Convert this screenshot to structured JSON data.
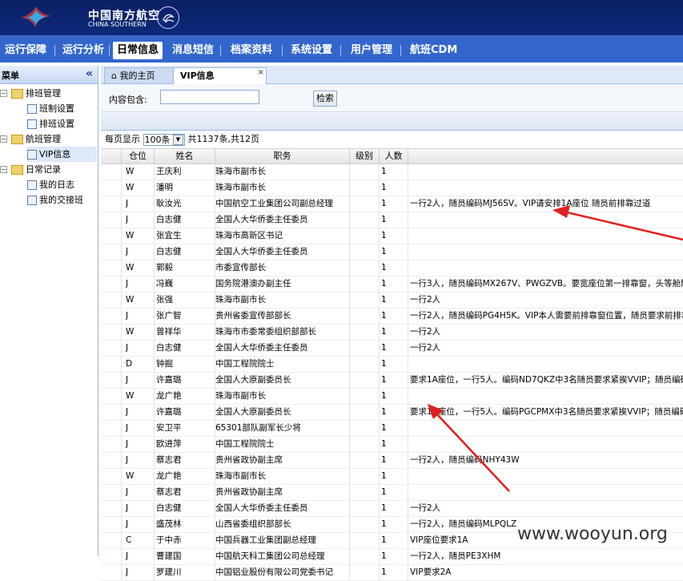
{
  "header": {
    "brand_cn": "中国南方航空",
    "brand_en": "CHINA SOUTHERN",
    "colors": {
      "bar": "#0b1f66",
      "nav": "#3366cc",
      "accent": "#e03b3b"
    }
  },
  "nav": [
    {
      "label": "运行保障"
    },
    {
      "label": "运行分析"
    },
    {
      "label": "日常信息",
      "active": true
    },
    {
      "label": "消息短信"
    },
    {
      "label": "档案资料"
    },
    {
      "label": "系统设置"
    },
    {
      "label": "用户管理"
    },
    {
      "label": "航班CDM"
    }
  ],
  "sidebar": {
    "title": "菜单",
    "collapse_icon": "double-chevron-left-icon",
    "items": [
      {
        "label": "排班管理",
        "type": "folder"
      },
      {
        "label": "班制设置",
        "type": "leaf"
      },
      {
        "label": "排班设置",
        "type": "leaf"
      },
      {
        "label": "航班管理",
        "type": "folder"
      },
      {
        "label": "VIP信息",
        "type": "leaf",
        "selected": true
      },
      {
        "label": "日常记录",
        "type": "folder"
      },
      {
        "label": "我的日志",
        "type": "leaf"
      },
      {
        "label": "我的交接班",
        "type": "leaf"
      }
    ]
  },
  "tabs": [
    {
      "label": "我的主页",
      "icon": "home-icon"
    },
    {
      "label": "VIP信息",
      "active": true,
      "close": "×"
    }
  ],
  "search": {
    "label": "内容包含:",
    "value": "",
    "button": "检索"
  },
  "paging": {
    "prefix": "每页显示",
    "page_size": "100条",
    "suffix": "共1137条,共12页"
  },
  "grid": {
    "columns": [
      "仓位",
      "姓名",
      "职务",
      "级别",
      "人数"
    ],
    "rows": [
      {
        "seat": "W",
        "name": "王庆利",
        "title": "珠海市副市长",
        "count": "1",
        "note": ""
      },
      {
        "seat": "W",
        "name": "潘明",
        "title": "珠海市副市长",
        "count": "1",
        "note": ""
      },
      {
        "seat": "J",
        "name": "耿汝光",
        "title": "中国航空工业集团公司副总经理",
        "count": "1",
        "note": "一行2人，随员编码MJ56SV。VIP请安排1A座位 随员前排靠过道"
      },
      {
        "seat": "J",
        "name": "白志健",
        "title": "全国人大华侨委主任委员",
        "count": "1",
        "note": ""
      },
      {
        "seat": "W",
        "name": "张宜生",
        "title": "珠海市高新区书记",
        "count": "1",
        "note": ""
      },
      {
        "seat": "J",
        "name": "白志健",
        "title": "全国人大华侨委主任委员",
        "count": "1",
        "note": ""
      },
      {
        "seat": "W",
        "name": "郭毅",
        "title": "市委宣传部长",
        "count": "1",
        "note": ""
      },
      {
        "seat": "J",
        "name": "冯巍",
        "title": "国务院港澳办副主任",
        "count": "1",
        "note": "一行3人，随员编码MX267V、PWGZVB。要宽座位第一排靠窗，头等舱随"
      },
      {
        "seat": "W",
        "name": "张强",
        "title": "珠海市副市长",
        "count": "1",
        "note": "一行2人"
      },
      {
        "seat": "J",
        "name": "张广智",
        "title": "贵州省委宣传部部长",
        "count": "1",
        "note": "一行2人，随员编码PG4H5K。VIP本人需要前排靠窗位置，随员要求前排靠"
      },
      {
        "seat": "W",
        "name": "曾祥华",
        "title": "珠海市市委常委组织部部长",
        "count": "1",
        "note": "一行2人"
      },
      {
        "seat": "J",
        "name": "白志健",
        "title": "全国人大华侨委主任委员",
        "count": "1",
        "note": "一行2人"
      },
      {
        "seat": "D",
        "name": "钟掘",
        "title": "中国工程院院士",
        "count": "1",
        "note": ""
      },
      {
        "seat": "J",
        "name": "许嘉璐",
        "title": "全国人大原副委员长",
        "count": "1",
        "note": "要求1A座位，一行5人。编码ND7QKZ中3名随员要求紧挨VVIP；随员编码"
      },
      {
        "seat": "W",
        "name": "龙广艳",
        "title": "珠海市副市长",
        "count": "1",
        "note": ""
      },
      {
        "seat": "J",
        "name": "许嘉璐",
        "title": "全国人大原副委员长",
        "count": "1",
        "note": "要求1A座位，一行5人。编码PGCPMX中3名随员要求紧挨VVIP；随员编码"
      },
      {
        "seat": "J",
        "name": "安卫平",
        "title": "65301部队副军长少将",
        "count": "1",
        "note": ""
      },
      {
        "seat": "J",
        "name": "欧进萍",
        "title": "中国工程院院士",
        "count": "1",
        "note": ""
      },
      {
        "seat": "J",
        "name": "蔡志君",
        "title": "贵州省政协副主席",
        "count": "1",
        "note": "一行2人，随员编码NHY43W"
      },
      {
        "seat": "W",
        "name": "龙广艳",
        "title": "珠海市副市长",
        "count": "1",
        "note": ""
      },
      {
        "seat": "J",
        "name": "蔡志君",
        "title": "贵州省政协副主席",
        "count": "1",
        "note": ""
      },
      {
        "seat": "J",
        "name": "白志健",
        "title": "全国人大华侨委主任委员",
        "count": "1",
        "note": "一行2人"
      },
      {
        "seat": "J",
        "name": "盛茂林",
        "title": "山西省委组织部部长",
        "count": "1",
        "note": "一行2人，随员编码MLPQLZ"
      },
      {
        "seat": "C",
        "name": "于中赤",
        "title": "中国兵器工业集团副总经理",
        "count": "1",
        "note": "VIP座位要求1A"
      },
      {
        "seat": "J",
        "name": "曹建国",
        "title": "中国航天科工集团公司总经理",
        "count": "1",
        "note": "一行2人，随员PE3XHM"
      },
      {
        "seat": "J",
        "name": "罗建川",
        "title": "中国铝业股份有限公司党委书记",
        "count": "1",
        "note": "VIP要求2A"
      }
    ]
  },
  "watermark": "www.wooyun.org"
}
